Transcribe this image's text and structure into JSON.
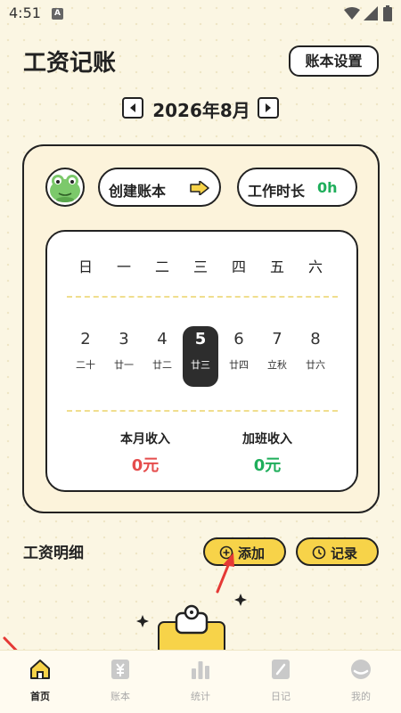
{
  "status": {
    "time": "4:51",
    "notif_glyph": "A",
    "icons": [
      "wifi-icon",
      "signal-icon",
      "battery-icon"
    ]
  },
  "header": {
    "title": "工资记账",
    "settings_label": "账本设置"
  },
  "month": {
    "label": "2026年8月"
  },
  "card": {
    "create_label": "创建账本",
    "worktime_label": "工作时长",
    "worktime_value": "0h",
    "weekdays": [
      "日",
      "一",
      "二",
      "三",
      "四",
      "五",
      "六"
    ],
    "days": [
      {
        "num": "2",
        "lunar": "二十"
      },
      {
        "num": "3",
        "lunar": "廿一"
      },
      {
        "num": "4",
        "lunar": "廿二"
      },
      {
        "num": "5",
        "lunar": "廿三"
      },
      {
        "num": "6",
        "lunar": "廿四"
      },
      {
        "num": "7",
        "lunar": "立秋"
      },
      {
        "num": "8",
        "lunar": "廿六"
      }
    ],
    "selected_day": "5",
    "month_income_label": "本月收入",
    "month_income_value": "0元",
    "overtime_income_label": "加班收入",
    "overtime_income_value": "0元"
  },
  "detail": {
    "title": "工资明细",
    "add_label": "添加",
    "record_label": "记录"
  },
  "tabs": [
    {
      "label": "首页",
      "icon": "home-icon",
      "active": true
    },
    {
      "label": "账本",
      "icon": "ledger-icon",
      "active": false
    },
    {
      "label": "统计",
      "icon": "stats-icon",
      "active": false
    },
    {
      "label": "日记",
      "icon": "diary-icon",
      "active": false
    },
    {
      "label": "我的",
      "icon": "profile-icon",
      "active": false
    }
  ],
  "colors": {
    "background": "#fbf6e3",
    "accent_yellow": "#f7d349",
    "income_red": "#e54d4d",
    "income_green": "#1fae5b",
    "worktime_green": "#1fae5b",
    "arrow_red": "#e53935"
  }
}
